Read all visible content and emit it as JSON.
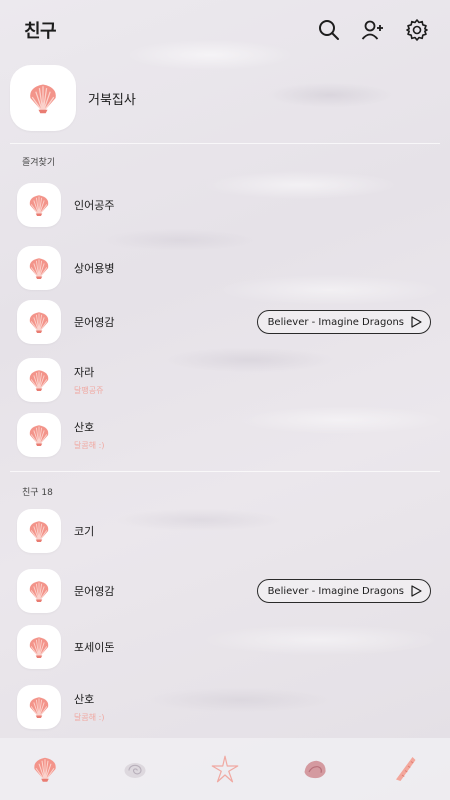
{
  "header": {
    "title": "친구",
    "icons": [
      "search-icon",
      "add-friend-icon",
      "settings-icon"
    ]
  },
  "me": {
    "name": "거북집사"
  },
  "favorites": {
    "label": "즐겨찾기",
    "items": [
      {
        "name": "인어공주",
        "status": "",
        "music": ""
      },
      {
        "name": "상어용병",
        "status": "",
        "music": ""
      },
      {
        "name": "문어영감",
        "status": "",
        "music": "Believer - Imagine Dragons"
      },
      {
        "name": "자라",
        "status": "달팽공쥬",
        "music": ""
      },
      {
        "name": "산호",
        "status": "달콤해 :)",
        "music": ""
      }
    ]
  },
  "friends": {
    "label": "친구 18",
    "items": [
      {
        "name": "코기",
        "status": "",
        "music": ""
      },
      {
        "name": "문어영감",
        "status": "",
        "music": "Believer - Imagine Dragons"
      },
      {
        "name": "포세이돈",
        "status": "",
        "music": ""
      },
      {
        "name": "산호",
        "status": "달콤해 :)",
        "music": ""
      }
    ]
  },
  "bottom_tabs": [
    "scallop-shell-icon",
    "snail-shell-icon",
    "starfish-icon",
    "conch-shell-icon",
    "spiral-shell-icon"
  ],
  "colors": {
    "accent": "#f0a9a2",
    "shell": "#f08a80",
    "text": "#1d1d1d"
  }
}
